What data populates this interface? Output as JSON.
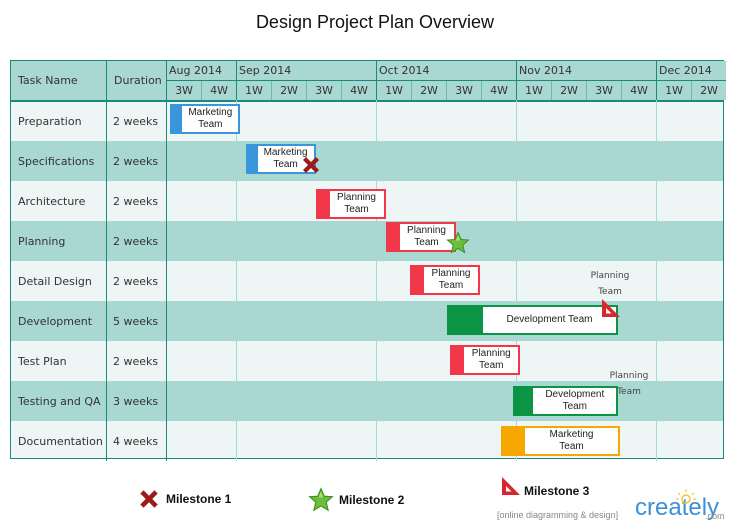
{
  "chart_data": {
    "type": "gantt",
    "title": "Design Project Plan Overview",
    "columns": [
      "Task Name",
      "Duration"
    ],
    "months": [
      {
        "label": "Aug 2014",
        "weeks": [
          "3W",
          "4W"
        ]
      },
      {
        "label": "Sep 2014",
        "weeks": [
          "1W",
          "2W",
          "3W",
          "4W"
        ]
      },
      {
        "label": "Oct 2014",
        "weeks": [
          "1W",
          "2W",
          "3W",
          "4W"
        ]
      },
      {
        "label": "Nov 2014",
        "weeks": [
          "1W",
          "2W",
          "3W",
          "4W"
        ]
      },
      {
        "label": "Dec 2014",
        "weeks": [
          "1W",
          "2W"
        ]
      }
    ],
    "tasks": [
      {
        "name": "Preparation",
        "duration": "2 weeks",
        "start_week": 0.15,
        "length_weeks": 2.0,
        "team": "Marketing Team",
        "color": "#3a96dc"
      },
      {
        "name": "Specifications",
        "duration": "2 weeks",
        "start_week": 2.3,
        "length_weeks": 2.0,
        "team": "Marketing Team",
        "color": "#3a96dc",
        "milestone": "milestone1"
      },
      {
        "name": "Architecture",
        "duration": "2 weeks",
        "start_week": 4.3,
        "length_weeks": 2.0,
        "team": "Planning Team",
        "color": "#f2374b"
      },
      {
        "name": "Planning",
        "duration": "2 weeks",
        "start_week": 6.3,
        "length_weeks": 2.0,
        "team": "Planning Team",
        "color": "#f2374b",
        "milestone": "milestone2"
      },
      {
        "name": "Detail Design",
        "duration": "2 weeks",
        "start_week": 7.0,
        "length_weeks": 2.0,
        "team": "Planning Team",
        "color": "#f2374b"
      },
      {
        "name": "Development",
        "duration": "5 weeks",
        "start_week": 8.05,
        "length_weeks": 4.9,
        "team": "Development Team",
        "color": "#0b9444",
        "milestone": "milestone3"
      },
      {
        "name": "Test Plan",
        "duration": "2 weeks",
        "start_week": 8.15,
        "length_weeks": 2.0,
        "team": "Planning Team",
        "color": "#f2374b"
      },
      {
        "name": "Testing and QA",
        "duration": "3 weeks",
        "start_week": 9.95,
        "length_weeks": 3.0,
        "team": "Development Team",
        "color": "#0b9444"
      },
      {
        "name": "Documentation",
        "duration": "4 weeks",
        "start_week": 9.6,
        "length_weeks": 3.4,
        "team": "Marketing Team",
        "color": "#f7a800"
      }
    ],
    "annotations": [
      {
        "text": "Planning Team",
        "row": 4,
        "near_week": 12.7
      },
      {
        "text": "Planning Team",
        "row": 7,
        "near_week": 13.3
      }
    ],
    "legend": [
      {
        "id": "milestone1",
        "label": "Milestone 1",
        "icon": "x-icon"
      },
      {
        "id": "milestone2",
        "label": "Milestone 2",
        "icon": "star-icon"
      },
      {
        "id": "milestone3",
        "label": "Milestone 3",
        "icon": "triangle-ruler-icon"
      }
    ]
  },
  "branding": {
    "tagline": "[online diagramming & design]",
    "name": "creately",
    "domain": ".com"
  }
}
